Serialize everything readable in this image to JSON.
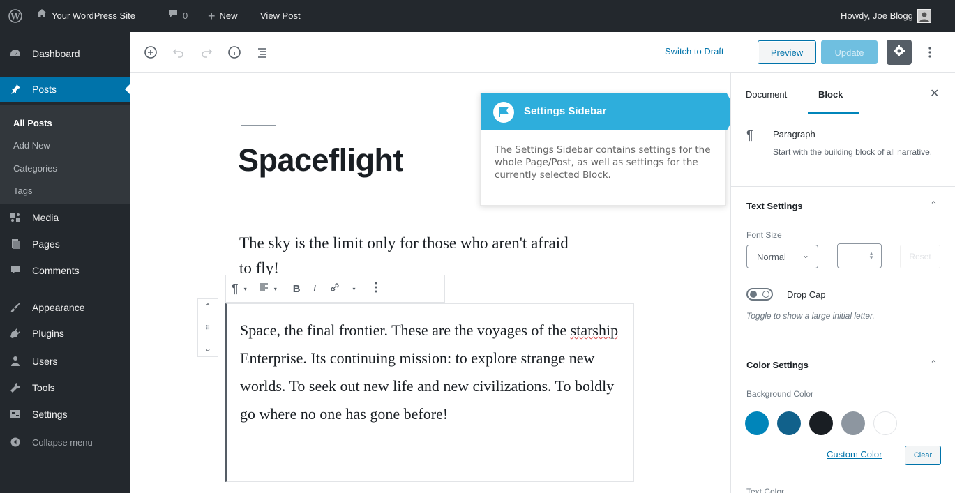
{
  "admin_bar": {
    "site_name": "Your WordPress Site",
    "comments_count": "0",
    "new_label": "New",
    "view_post_label": "View Post",
    "howdy": "Howdy, Joe Blogg"
  },
  "menu": {
    "items": [
      {
        "label": "Dashboard",
        "icon": "dashboard-icon"
      },
      {
        "label": "Posts",
        "icon": "pin-icon",
        "current": true
      },
      {
        "label": "Media",
        "icon": "media-icon"
      },
      {
        "label": "Pages",
        "icon": "pages-icon"
      },
      {
        "label": "Comments",
        "icon": "comment-icon"
      },
      {
        "label": "Appearance",
        "icon": "paintbrush-icon"
      },
      {
        "label": "Plugins",
        "icon": "plugin-icon"
      },
      {
        "label": "Users",
        "icon": "users-icon"
      },
      {
        "label": "Tools",
        "icon": "wrench-icon"
      },
      {
        "label": "Settings",
        "icon": "settings-icon"
      }
    ],
    "submenu": [
      "All Posts",
      "Add New",
      "Categories",
      "Tags"
    ],
    "collapse_label": "Collapse menu"
  },
  "header": {
    "switch_to_draft": "Switch to Draft",
    "preview": "Preview",
    "update": "Update"
  },
  "post": {
    "title": "Spaceflight",
    "paragraph1": "The sky is the limit only for those who aren't afraid",
    "paragraph1_cut": "to fly!",
    "selected_block_before": "Space, the final frontier. These are the voyages of the ",
    "selected_block_spell": "starship",
    "selected_block_after": " Enterprise. Its  continuing mission: to explore strange new worlds. To seek out new life  and new civilizations. To boldly go where no one has gone before!"
  },
  "block_toolbar": {
    "paragraph_symbol": "¶",
    "bold": "B",
    "italic": "I"
  },
  "tooltip": {
    "title": "Settings Sidebar",
    "body": "The Settings Sidebar contains settings for the whole Page/Post, as well as settings for the currently selected Block."
  },
  "sidebar": {
    "tabs": {
      "document": "Document",
      "block": "Block"
    },
    "active_tab": "Block",
    "block_card": {
      "icon": "¶",
      "title": "Paragraph",
      "description": "Start with the building block of all narrative."
    },
    "text_settings": {
      "title": "Text Settings",
      "font_size_label": "Font Size",
      "font_size_value": "Normal",
      "reset": "Reset",
      "drop_cap_label": "Drop Cap",
      "drop_cap_help": "Toggle to show a large initial letter."
    },
    "color_settings": {
      "title": "Color Settings",
      "background_label": "Background Color",
      "swatches": [
        "#0085ba",
        "#11618b",
        "#191e23",
        "#8d96a0",
        "#ffffff"
      ],
      "custom_color": "Custom Color",
      "clear": "Clear",
      "text_color_label": "Text Color"
    }
  }
}
